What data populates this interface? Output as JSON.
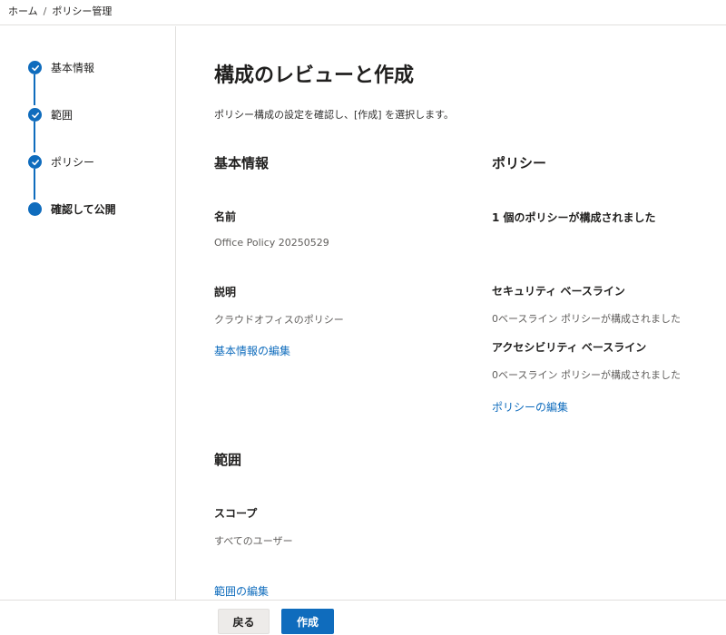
{
  "breadcrumb": {
    "home": "ホーム",
    "separator": "/",
    "current": "ポリシー管理"
  },
  "steps": [
    {
      "label": "基本情報",
      "state": "done"
    },
    {
      "label": "範囲",
      "state": "done"
    },
    {
      "label": "ポリシー",
      "state": "done"
    },
    {
      "label": "確認して公開",
      "state": "current"
    }
  ],
  "page": {
    "title": "構成のレビューと作成",
    "intro": "ポリシー構成の設定を確認し、[作成] を選択します。"
  },
  "basics": {
    "heading": "基本情報",
    "name_label": "名前",
    "name_value": "Office Policy 20250529",
    "desc_label": "説明",
    "desc_value": "クラウドオフィスのポリシー",
    "edit_link": "基本情報の編集"
  },
  "policy": {
    "heading": "ポリシー",
    "summary": "1 個のポリシーが構成されました",
    "security_label": "セキュリティ ベースライン",
    "security_value": "0ベースライン ポリシーが構成されました",
    "accessibility_label": "アクセシビリティ ベースライン",
    "accessibility_value": "0ベースライン ポリシーが構成されました",
    "edit_link": "ポリシーの編集"
  },
  "scope": {
    "heading": "範囲",
    "scope_label": "スコープ",
    "scope_value": "すべてのユーザー",
    "edit_link": "範囲の編集"
  },
  "footer": {
    "back_label": "戻る",
    "create_label": "作成"
  },
  "colors": {
    "accent": "#0f6cbd",
    "border": "#e1dfdd",
    "muted_text": "#605e5c"
  },
  "icons": {
    "step_done": "check-icon",
    "step_current": "current-step-dot-icon"
  }
}
